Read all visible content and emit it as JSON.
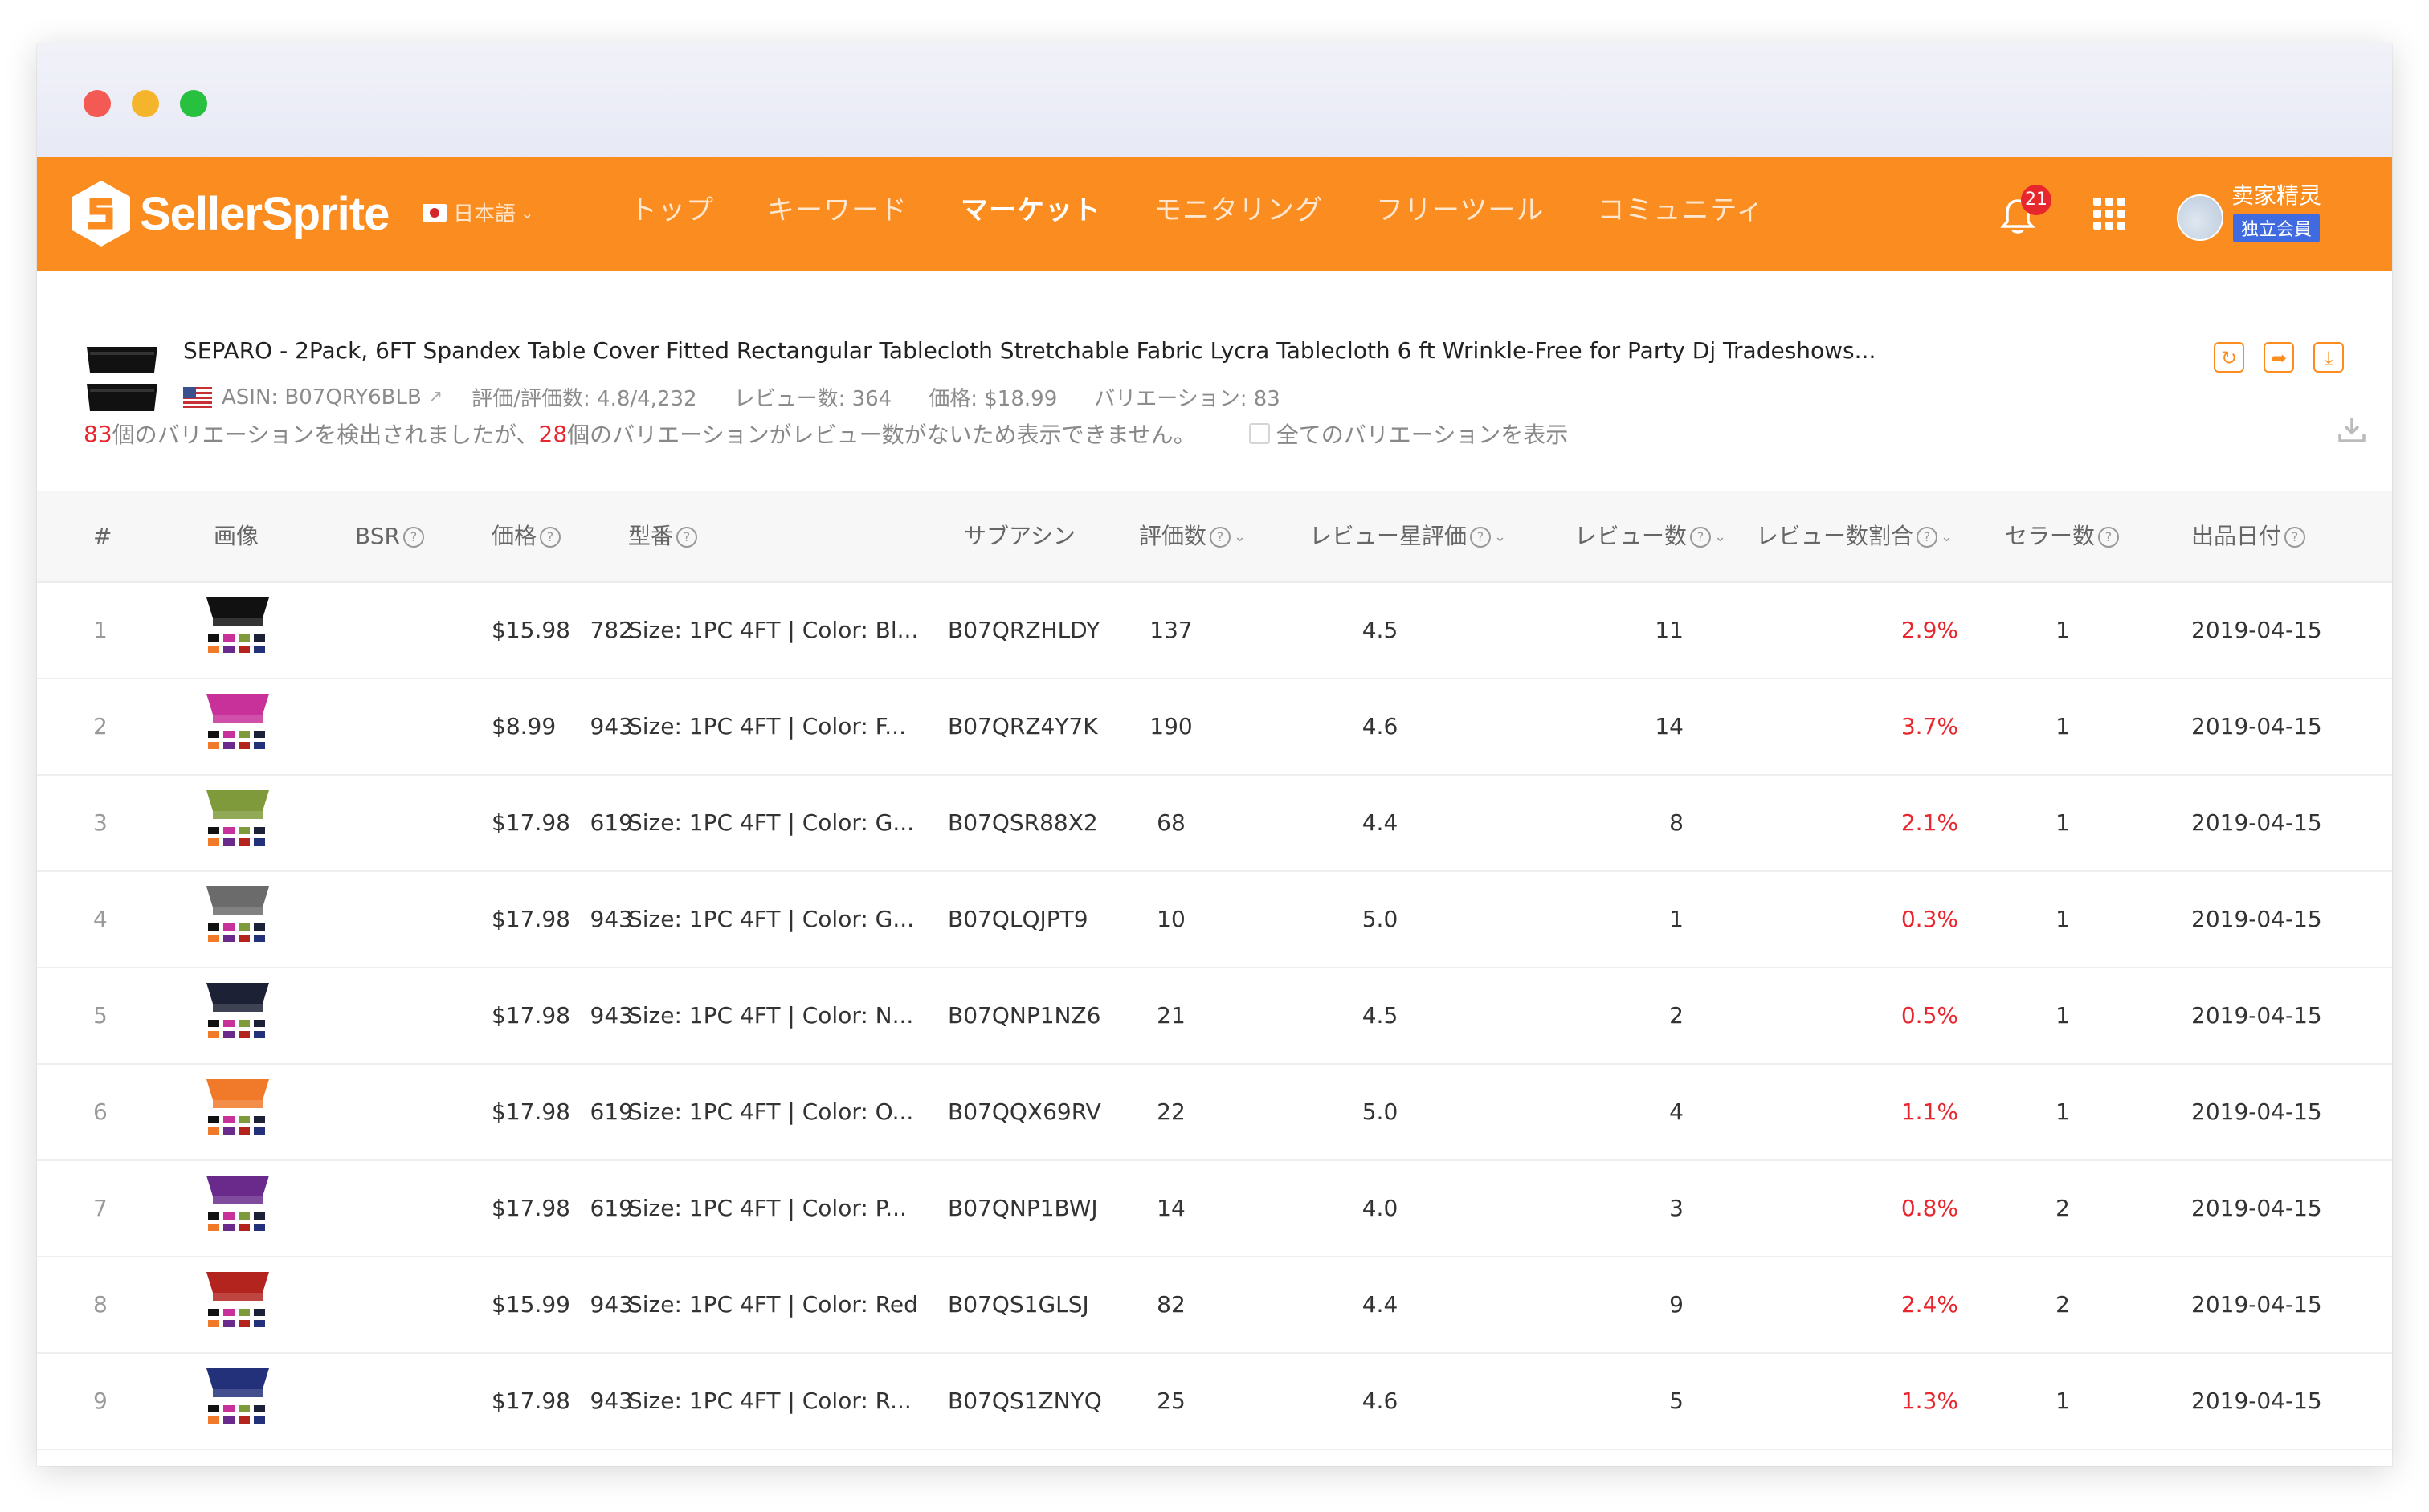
{
  "nav": {
    "brand": "SellerSprite",
    "language": "日本語",
    "menu": [
      "トップ",
      "キーワード",
      "マーケット",
      "モニタリング",
      "フリーツール",
      "コミュニティ"
    ],
    "active_menu": "マーケット",
    "notification_count": "21",
    "username": "卖家精灵",
    "member_tag": "独立会員",
    "brand_color": "#fb8c1f"
  },
  "product": {
    "title": "SEPARO - 2Pack, 6FT Spandex Table Cover Fitted Rectangular Tablecloth Stretchable Fabric Lycra Tablecloth 6 ft Wrinkle-Free for Party Dj Tradeshows...",
    "asin": "ASIN: B07QRY6BLB",
    "rating": "評価/評価数: 4.8/4,232",
    "reviews": "レビュー数: 364",
    "price": "価格: $18.99",
    "variations": "バリエーション: 83"
  },
  "notice": {
    "count_detected": "83",
    "text1": "個のバリエーションを検出されましたが、",
    "count_hidden": "28",
    "text2": "個のバリエーションがレビュー数がないため表示できません。",
    "show_all": "全てのバリエーションを表示"
  },
  "table": {
    "headers": [
      "#",
      "画像",
      "BSR",
      "価格",
      "型番",
      "サブアシン",
      "評価数",
      "レビュー星評価",
      "レビュー数",
      "レビュー数割合",
      "セラー数",
      "出品日付"
    ],
    "rows": [
      {
        "idx": "1",
        "bsr": "782",
        "price": "$15.98",
        "model": "Size: 1PC 4FT | Color: Bl...",
        "asin": "B07QRZHLDY",
        "ratings": "137",
        "stars": "4.5",
        "reviews": "11",
        "ratio": "2.9%",
        "sellers": "1",
        "date": "2019-04-15",
        "color": "#111111"
      },
      {
        "idx": "2",
        "bsr": "943",
        "price": "$8.99",
        "model": "Size: 1PC 4FT | Color: F...",
        "asin": "B07QRZ4Y7K",
        "ratings": "190",
        "stars": "4.6",
        "reviews": "14",
        "ratio": "3.7%",
        "sellers": "1",
        "date": "2019-04-15",
        "color": "#c8309a"
      },
      {
        "idx": "3",
        "bsr": "619",
        "price": "$17.98",
        "model": "Size: 1PC 4FT | Color: G...",
        "asin": "B07QSR88X2",
        "ratings": "68",
        "stars": "4.4",
        "reviews": "8",
        "ratio": "2.1%",
        "sellers": "1",
        "date": "2019-04-15",
        "color": "#7f9a3a"
      },
      {
        "idx": "4",
        "bsr": "943",
        "price": "$17.98",
        "model": "Size: 1PC 4FT | Color: G...",
        "asin": "B07QLQJPT9",
        "ratings": "10",
        "stars": "5.0",
        "reviews": "1",
        "ratio": "0.3%",
        "sellers": "1",
        "date": "2019-04-15",
        "color": "#6b6b6b"
      },
      {
        "idx": "5",
        "bsr": "943",
        "price": "$17.98",
        "model": "Size: 1PC 4FT | Color: N...",
        "asin": "B07QNP1NZ6",
        "ratings": "21",
        "stars": "4.5",
        "reviews": "2",
        "ratio": "0.5%",
        "sellers": "1",
        "date": "2019-04-15",
        "color": "#1c2135"
      },
      {
        "idx": "6",
        "bsr": "619",
        "price": "$17.98",
        "model": "Size: 1PC 4FT | Color: O...",
        "asin": "B07QQX69RV",
        "ratings": "22",
        "stars": "5.0",
        "reviews": "4",
        "ratio": "1.1%",
        "sellers": "1",
        "date": "2019-04-15",
        "color": "#f07a2a"
      },
      {
        "idx": "7",
        "bsr": "619",
        "price": "$17.98",
        "model": "Size: 1PC 4FT | Color: P...",
        "asin": "B07QNP1BWJ",
        "ratings": "14",
        "stars": "4.0",
        "reviews": "3",
        "ratio": "0.8%",
        "sellers": "2",
        "date": "2019-04-15",
        "color": "#6a2a8c"
      },
      {
        "idx": "8",
        "bsr": "943",
        "price": "$15.99",
        "model": "Size: 1PC 4FT | Color: Red",
        "asin": "B07QS1GLSJ",
        "ratings": "82",
        "stars": "4.4",
        "reviews": "9",
        "ratio": "2.4%",
        "sellers": "2",
        "date": "2019-04-15",
        "color": "#b3241f"
      },
      {
        "idx": "9",
        "bsr": "943",
        "price": "$17.98",
        "model": "Size: 1PC 4FT | Color: R...",
        "asin": "B07QS1ZNYQ",
        "ratings": "25",
        "stars": "4.6",
        "reviews": "5",
        "ratio": "1.3%",
        "sellers": "1",
        "date": "2019-04-15",
        "color": "#23307a"
      }
    ]
  }
}
